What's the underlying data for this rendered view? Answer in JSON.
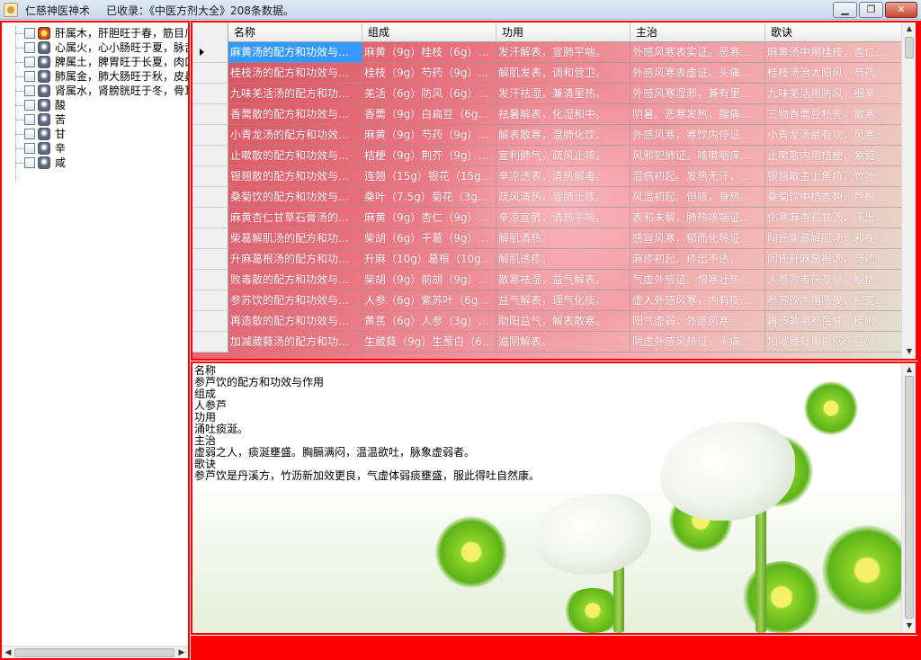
{
  "window": {
    "app_name": "仁慈神医神术",
    "status_text": "已收录：《中医方剂大全》208条数据。",
    "min_label": "▁",
    "max_label": "❐",
    "close_label": "✕"
  },
  "tree": {
    "items": [
      {
        "label": "肝属木，肝胆旺于春，筋目爪"
      },
      {
        "label": "心属火，心小肠旺于夏，脉舌"
      },
      {
        "label": "脾属土，脾胃旺于长夏，肉口"
      },
      {
        "label": "肺属金，肺大肠旺于秋，皮鼻"
      },
      {
        "label": "肾属水，肾膀胱旺于冬，骨耳"
      },
      {
        "label": "酸"
      },
      {
        "label": "苦"
      },
      {
        "label": "甘"
      },
      {
        "label": "辛"
      },
      {
        "label": "咸"
      }
    ]
  },
  "grid": {
    "columns": [
      "名称",
      "组成",
      "功用",
      "主治",
      "歌诀"
    ],
    "rows": [
      [
        "麻黄汤的配方和功效与…",
        "麻黄（9g）桂枝（6g）…",
        "发汗解表，宣肺平喘。",
        "外感风寒表实证。恶寒…",
        "麻黄汤中用桂枝，杏仁…"
      ],
      [
        "桂枝汤的配方和功效与…",
        "桂枝（9g）芍药（9g）…",
        "解肌发表，调和营卫。",
        "外感风寒表虚证。头痛…",
        "桂枝汤治太阳风，芍药…"
      ],
      [
        "九味羌活汤的配方和功…",
        "羌活（6g）防风（6g）…",
        "发汗祛湿，兼清里热。",
        "外感风寒湿邪，兼有里…",
        "九味羌活用防风，细辛…"
      ],
      [
        "香薷散的配方和功效与…",
        "香薷（9g）白扁豆（6g…",
        "祛暑解表，化湿和中。",
        "阴暑。恶寒发热，腹痛…",
        "三物香薷豆朴先，散寒…"
      ],
      [
        "小青龙汤的配方和功效…",
        "麻黄（9g）芍药（9g）…",
        "解表散寒，温肺化饮。",
        "外感风寒，寒饮内停证…",
        "小青龙汤最有功，风寒…"
      ],
      [
        "止嗽散的配方和功效与…",
        "桔梗（9g）荆芥（9g）…",
        "宣利肺气，疏风止咳。",
        "风邪犯肺证。咳嗽咽痒…",
        "止嗽散内用桔梗，紫菀…"
      ],
      [
        "银翘散的配方和功效与…",
        "连翘（15g）银花（15g…",
        "辛凉透表，清热解毒。",
        "温病初起。发热无汗，…",
        "银翘散主上焦疴，竹叶…"
      ],
      [
        "桑菊饮的配方和功效与…",
        "桑叶（7.5g）菊花（3g…",
        "疏风清热，宣肺止咳。",
        "风温初起。但咳，身热…",
        "桑菊饮中桔杏翘，芦根…"
      ],
      [
        "麻黄杏仁甘草石膏汤的…",
        "麻黄（9g）杏仁（9g）…",
        "辛凉宣肺，清热平喘。",
        "表邪未解，肺热咳喘证…",
        "伤寒麻杏石甘汤，汗出…"
      ],
      [
        "柴葛解肌汤的配方和功…",
        "柴胡（6g）干葛（9g）…",
        "解肌清热。",
        "感冒风寒，郁而化热证…",
        "陶氏柴葛解肌汤，邪在…"
      ],
      [
        "升麻葛根汤的配方和功…",
        "升麻（10g）葛根（10g…",
        "解肌透疹。",
        "麻疹初起。疹出不透，…",
        "阎氏升麻葛根汤，芍药…"
      ],
      [
        "败毒散的配方和功效与…",
        "柴胡（9g）前胡（9g）…",
        "散寒祛湿，益气解表。",
        "气虚外感证。憎寒壮热…",
        "人参败毒茯苓草，枳桔…"
      ],
      [
        "参苏饮的配方和功效与…",
        "人参（6g）紫苏叶（6g…",
        "益气解表，理气化痰。",
        "虚人外感风寒，内有痰…",
        "参苏饮内用陈皮，枳壳…"
      ],
      [
        "再造散的配方和功效与…",
        "黄芪（6g）人参（3g）…",
        "助阳益气，解表散寒。",
        "阳气虚弱，外感风寒。…",
        "再造散用参芪甘，桂附…"
      ],
      [
        "加减葳蕤汤的配方和功…",
        "生葳蕤（9g）生葱白（6…",
        "滋阴解表。",
        "阴虚外感风热证。头痛…",
        "加减葳蕤用白薇，豆豉…"
      ]
    ]
  },
  "detail": {
    "lines": [
      "名称",
      "参芦饮的配方和功效与作用",
      "组成",
      "人参芦",
      "功用",
      "涌吐痰涎。",
      "主治",
      "虚弱之人，痰涎壅盛。胸膈满闷，温温欲吐，脉象虚弱者。",
      "歌诀",
      "参芦饮是丹溪方，竹沥新加效更良，气虚体弱痰壅盛，服此得吐自然康。"
    ]
  },
  "colors": {
    "border_accent": "#ff0000",
    "selection": "#3399ff"
  }
}
